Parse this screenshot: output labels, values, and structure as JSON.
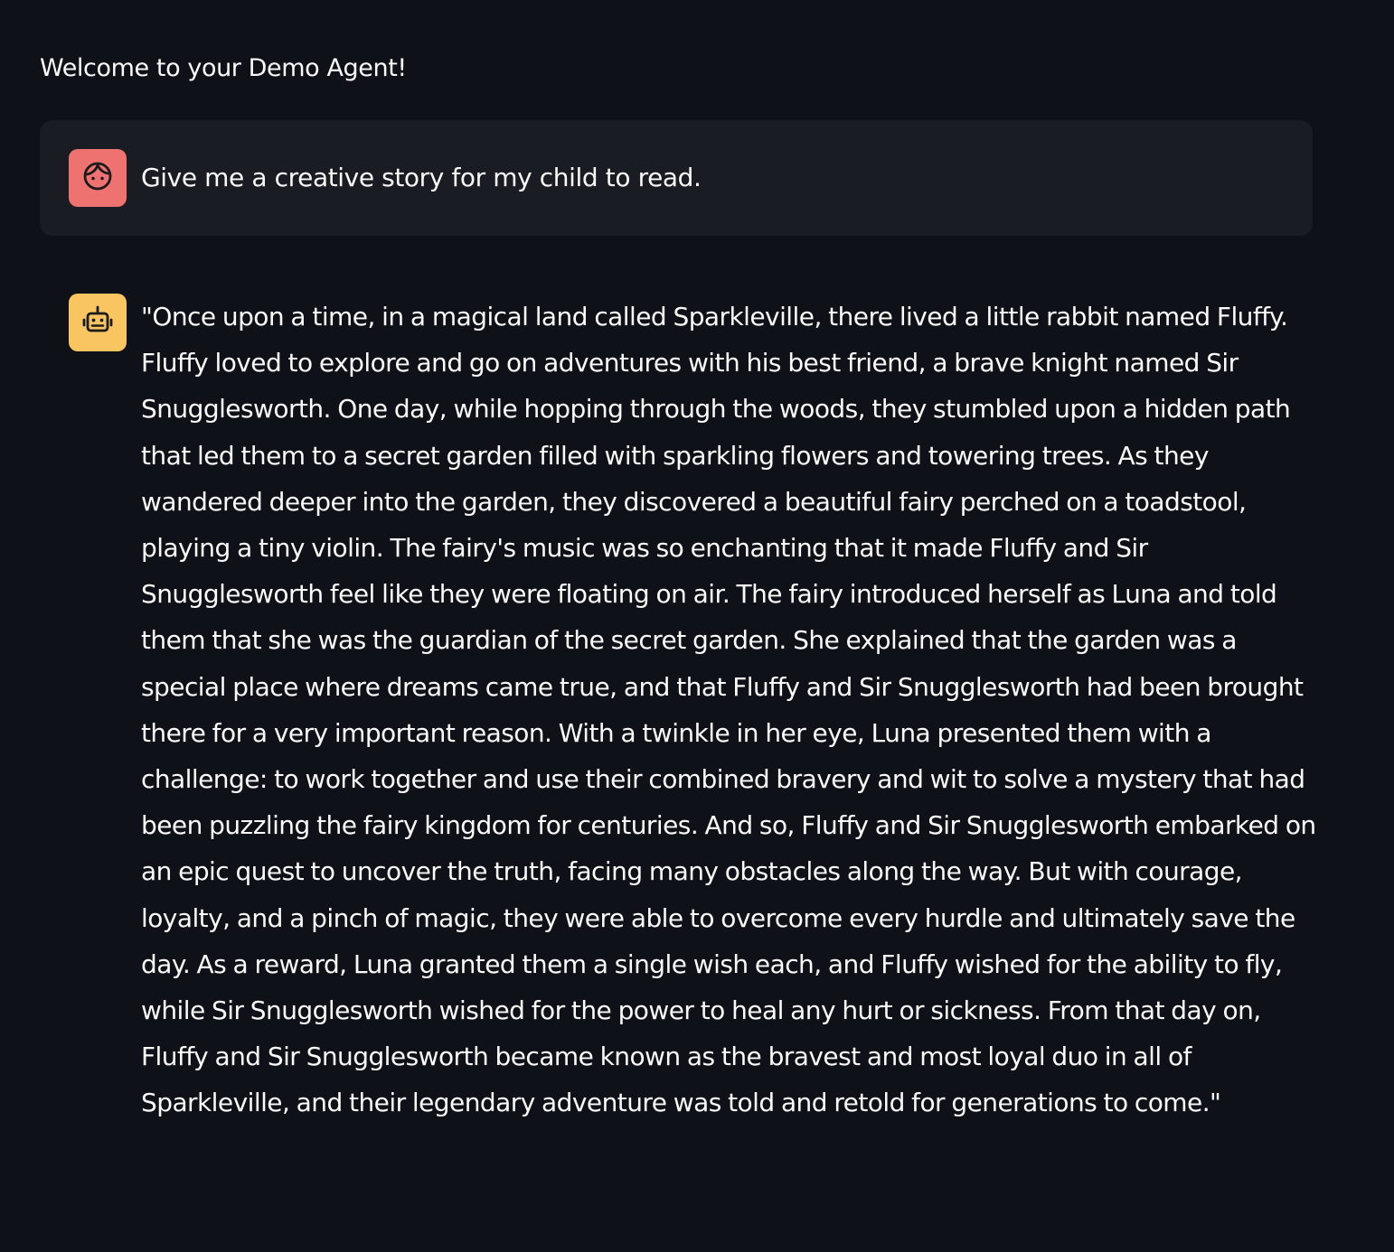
{
  "header": {
    "welcome": "Welcome to your Demo Agent!"
  },
  "messages": [
    {
      "role": "user",
      "avatar_icon": "user-face-icon",
      "avatar_color": "#ee7370",
      "text": "Give me a creative story for my child to read."
    },
    {
      "role": "assistant",
      "avatar_icon": "robot-icon",
      "avatar_color": "#f8c560",
      "text": "\"Once upon a time, in a magical land called Sparkleville, there lived a little rabbit named Fluffy. Fluffy loved to explore and go on adventures with his best friend, a brave knight named Sir Snugglesworth. One day, while hopping through the woods, they stumbled upon a hidden path that led them to a secret garden filled with sparkling flowers and towering trees. As they wandered deeper into the garden, they discovered a beautiful fairy perched on a toadstool, playing a tiny violin. The fairy's music was so enchanting that it made Fluffy and Sir Snugglesworth feel like they were floating on air. The fairy introduced herself as Luna and told them that she was the guardian of the secret garden. She explained that the garden was a special place where dreams came true, and that Fluffy and Sir Snugglesworth had been brought there for a very important reason. With a twinkle in her eye, Luna presented them with a challenge: to work together and use their combined bravery and wit to solve a mystery that had been puzzling the fairy kingdom for centuries. And so, Fluffy and Sir Snugglesworth embarked on an epic quest to uncover the truth, facing many obstacles along the way. But with courage, loyalty, and a pinch of magic, they were able to overcome every hurdle and ultimately save the day. As a reward, Luna granted them a single wish each, and Fluffy wished for the ability to fly, while Sir Snugglesworth wished for the power to heal any hurt or sickness. From that day on, Fluffy and Sir Snugglesworth became known as the bravest and most loyal duo in all of Sparkleville, and their legendary adventure was told and retold for generations to come.\""
    }
  ],
  "theme": {
    "background": "#0e1117",
    "user_bubble": "#1a1c24",
    "text": "#fafafa"
  }
}
